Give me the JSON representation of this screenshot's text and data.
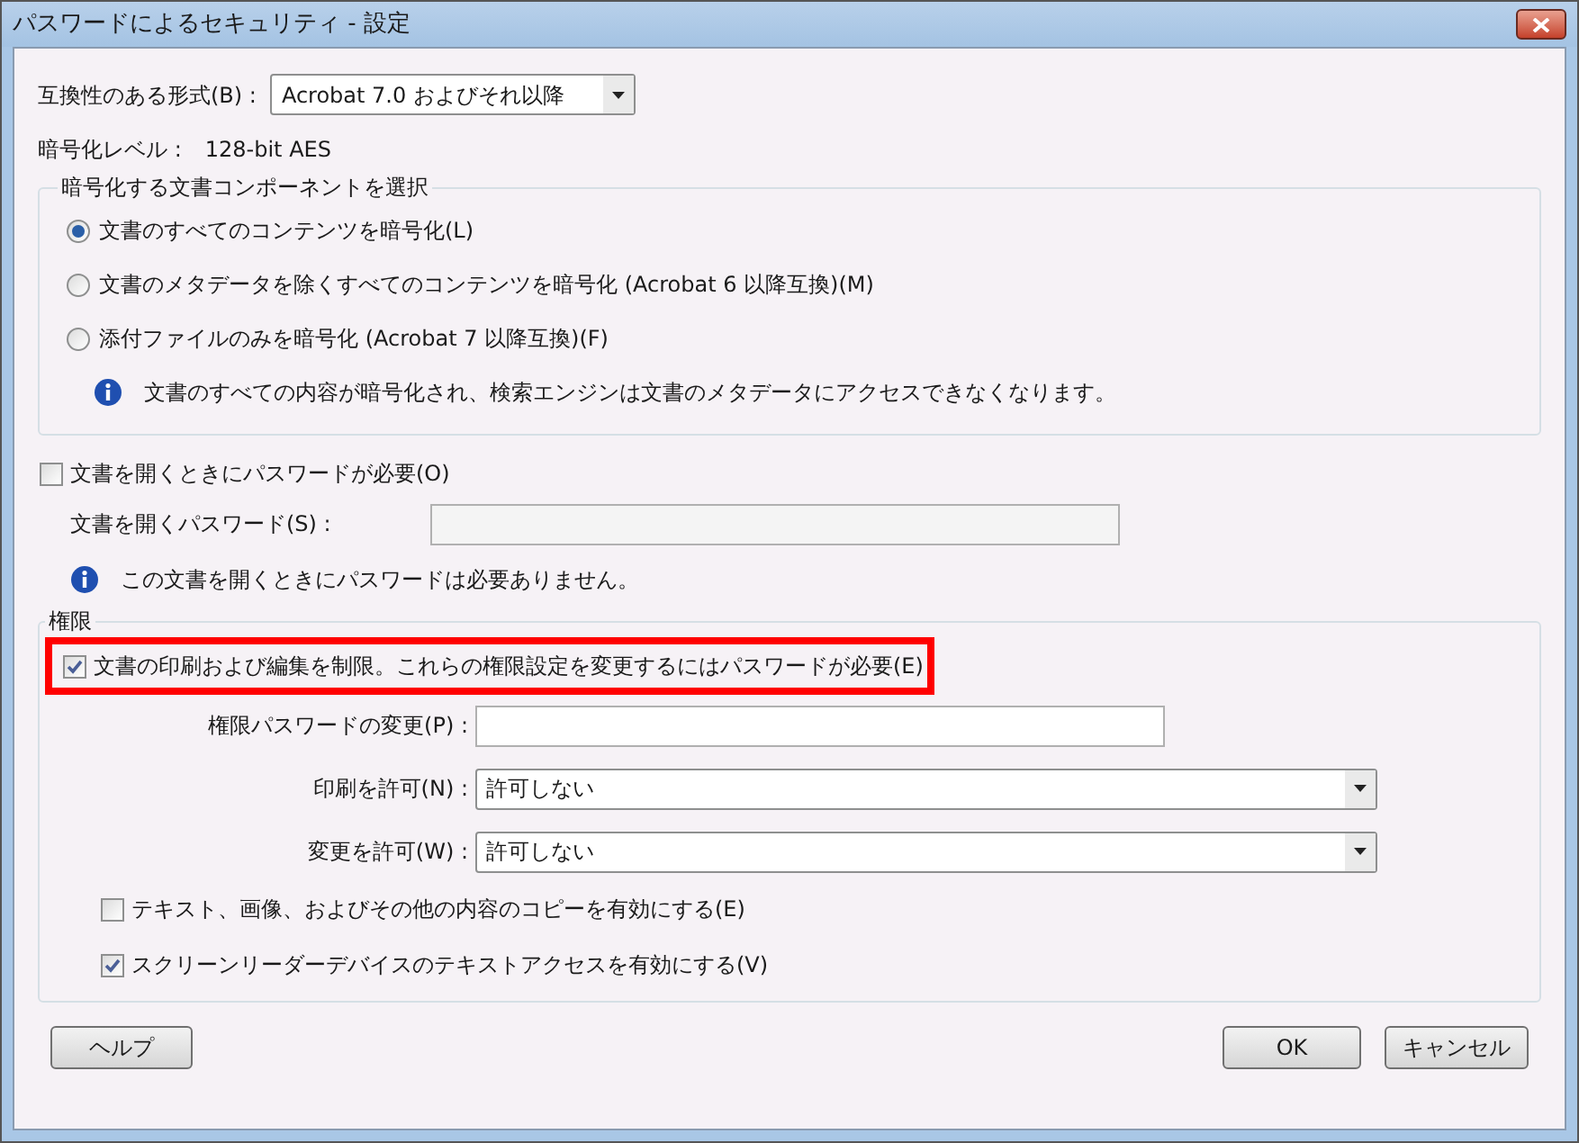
{
  "window": {
    "title": "パスワードによるセキュリティ - 設定"
  },
  "compatibility": {
    "label": "互換性のある形式(B) :",
    "value": "Acrobat 7.0 およびそれ以降"
  },
  "encryption_level": {
    "label": "暗号化レベル :",
    "value": "128-bit AES"
  },
  "components": {
    "title": "暗号化する文書コンポーネントを選択",
    "options": [
      {
        "label": "文書のすべてのコンテンツを暗号化(L)",
        "selected": true
      },
      {
        "label": "文書のメタデータを除くすべてのコンテンツを暗号化 (Acrobat 6 以降互換)(M)",
        "selected": false
      },
      {
        "label": "添付ファイルのみを暗号化 (Acrobat 7 以降互換)(F)",
        "selected": false
      }
    ],
    "info": "文書のすべての内容が暗号化され、検索エンジンは文書のメタデータにアクセスできなくなります。"
  },
  "open_password": {
    "required": {
      "label": "文書を開くときにパスワードが必要(O)",
      "checked": false
    },
    "field_label": "文書を開くパスワード(S) :",
    "field_disabled": true,
    "info": "この文書を開くときにパスワードは必要ありません。"
  },
  "permissions": {
    "title": "権限",
    "restrict": {
      "label": "文書の印刷および編集を制限。これらの権限設定を変更するにはパスワードが必要(E)",
      "checked": true,
      "highlighted": true
    },
    "password_label": "権限パスワードの変更(P) :",
    "print": {
      "label": "印刷を許可(N) :",
      "value": "許可しない"
    },
    "change": {
      "label": "変更を許可(W) :",
      "value": "許可しない"
    },
    "options": [
      {
        "label": "テキスト、画像、およびその他の内容のコピーを有効にする(E)",
        "checked": false
      },
      {
        "label": "スクリーンリーダーデバイスのテキストアクセスを有効にする(V)",
        "checked": true
      }
    ]
  },
  "buttons": [
    {
      "label": "ヘルプ",
      "kind": "help"
    },
    {
      "label": "OK",
      "kind": "default"
    },
    {
      "label": "キャンセル",
      "kind": "normal"
    }
  ]
}
